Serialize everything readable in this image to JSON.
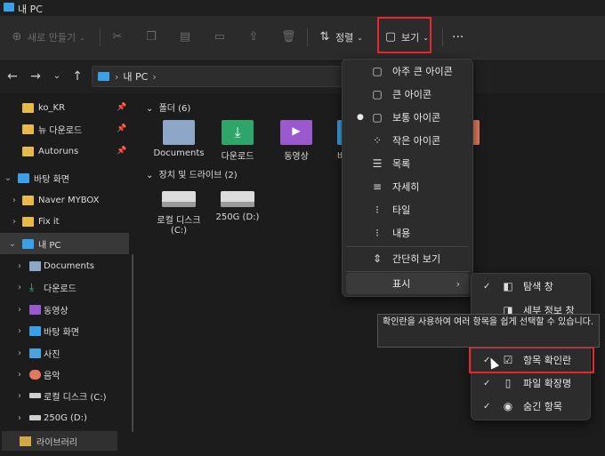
{
  "window": {
    "title": "내 PC"
  },
  "toolbar": {
    "new_label": "새로 만들기",
    "sort_label": "정렬",
    "view_label": "보기",
    "more_label": "···"
  },
  "address": {
    "path_item": "내 PC",
    "path_sep": "›"
  },
  "sidebar": {
    "items": [
      {
        "label": "ko_KR"
      },
      {
        "label": "뉴 다운로드"
      },
      {
        "label": "Autoruns"
      },
      {
        "label": "바탕 화면"
      },
      {
        "label": "Naver MYBOX"
      },
      {
        "label": "Fix it"
      },
      {
        "label": "내 PC"
      },
      {
        "label": "Documents"
      },
      {
        "label": "다운로드"
      },
      {
        "label": "동영상"
      },
      {
        "label": "바탕 화면"
      },
      {
        "label": "사진"
      },
      {
        "label": "음악"
      },
      {
        "label": "로컬 디스크 (C:)"
      },
      {
        "label": "250G (D:)"
      }
    ],
    "drag_label": "라이브러리"
  },
  "content": {
    "folders_header": "폴더 (6)",
    "folders": [
      {
        "label": "Documents"
      },
      {
        "label": "다운로드"
      },
      {
        "label": "동영상"
      },
      {
        "label": "바"
      },
      {
        "label": "악"
      }
    ],
    "drives_header": "장치 및 드라이브 (2)",
    "drives": [
      {
        "label": "로컬 디스크 (C:)"
      },
      {
        "label": "250G (D:)"
      }
    ]
  },
  "view_menu": {
    "items": [
      {
        "label": "아주 큰 아이콘"
      },
      {
        "label": "큰 아이콘"
      },
      {
        "label": "보통 아이콘"
      },
      {
        "label": "작은 아이콘"
      },
      {
        "label": "목록"
      },
      {
        "label": "자세히"
      },
      {
        "label": "타일"
      },
      {
        "label": "내용"
      },
      {
        "label": "간단히 보기"
      },
      {
        "label": "표시"
      }
    ]
  },
  "show_submenu": {
    "items": [
      {
        "label": "탐색 창"
      },
      {
        "label": "세부 정보 창"
      },
      {
        "label": "항목 확인란"
      },
      {
        "label": "파일 확장명"
      },
      {
        "label": "숨긴 항목"
      }
    ]
  },
  "tooltip": {
    "text": "확인란을 사용하여 여러 항목을 쉽게 선택할 수 있습니다."
  },
  "colors": {
    "accent": "#3aa0e8",
    "highlight": "#e8262d"
  }
}
